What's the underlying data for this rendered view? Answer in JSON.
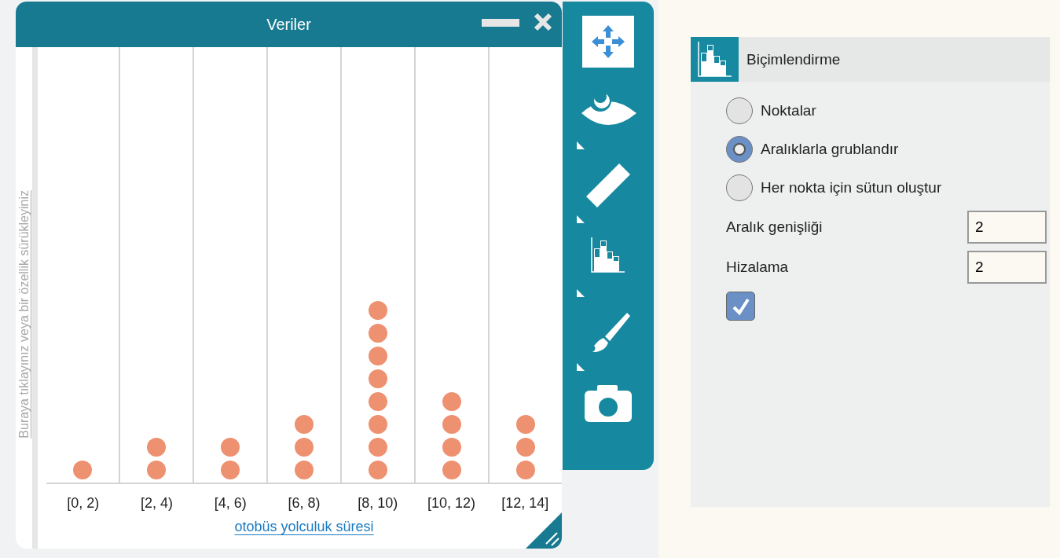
{
  "window": {
    "title": "Veriler"
  },
  "plot": {
    "drop_hint": "Buraya tıklayınız veya bir özellik sürükleyiniz",
    "columns": [
      {
        "label": "[0, 2)",
        "dots": [
          {
            "kind": "point"
          }
        ]
      },
      {
        "label": "[2, 4)",
        "dots": [
          {
            "kind": "point"
          },
          {
            "kind": "point"
          }
        ]
      },
      {
        "label": "[4, 6)",
        "dots": [
          {
            "kind": "point"
          },
          {
            "kind": "point"
          }
        ]
      },
      {
        "label": "[6, 8)",
        "dots": [
          {
            "kind": "point"
          },
          {
            "kind": "point"
          },
          {
            "kind": "point"
          }
        ]
      },
      {
        "label": "[8, 10)",
        "dots": [
          {
            "kind": "point"
          },
          {
            "kind": "point"
          },
          {
            "kind": "point"
          },
          {
            "kind": "point"
          },
          {
            "kind": "point"
          },
          {
            "kind": "point"
          },
          {
            "kind": "point"
          },
          {
            "kind": "point"
          }
        ]
      },
      {
        "label": "[10, 12)",
        "dots": [
          {
            "kind": "point"
          },
          {
            "kind": "point"
          },
          {
            "kind": "point"
          },
          {
            "kind": "point"
          }
        ]
      },
      {
        "label": "[12, 14]",
        "dots": [
          {
            "kind": "point"
          },
          {
            "kind": "point"
          },
          {
            "kind": "point"
          }
        ]
      }
    ],
    "axis_label": "otobüs yolculuk süresi"
  },
  "format_panel": {
    "title": "Biçimlendirme",
    "options": [
      {
        "label": "Noktalar",
        "selected": false
      },
      {
        "label": "Aralıklarla grublandır",
        "selected": true
      },
      {
        "label": "Her nokta için sütun oluştur",
        "selected": false
      }
    ],
    "fields": [
      {
        "label": "Aralık genişliği",
        "value": "2"
      },
      {
        "label": "Hizalama",
        "value": "2"
      }
    ],
    "checkbox": {
      "checked": true
    }
  }
}
